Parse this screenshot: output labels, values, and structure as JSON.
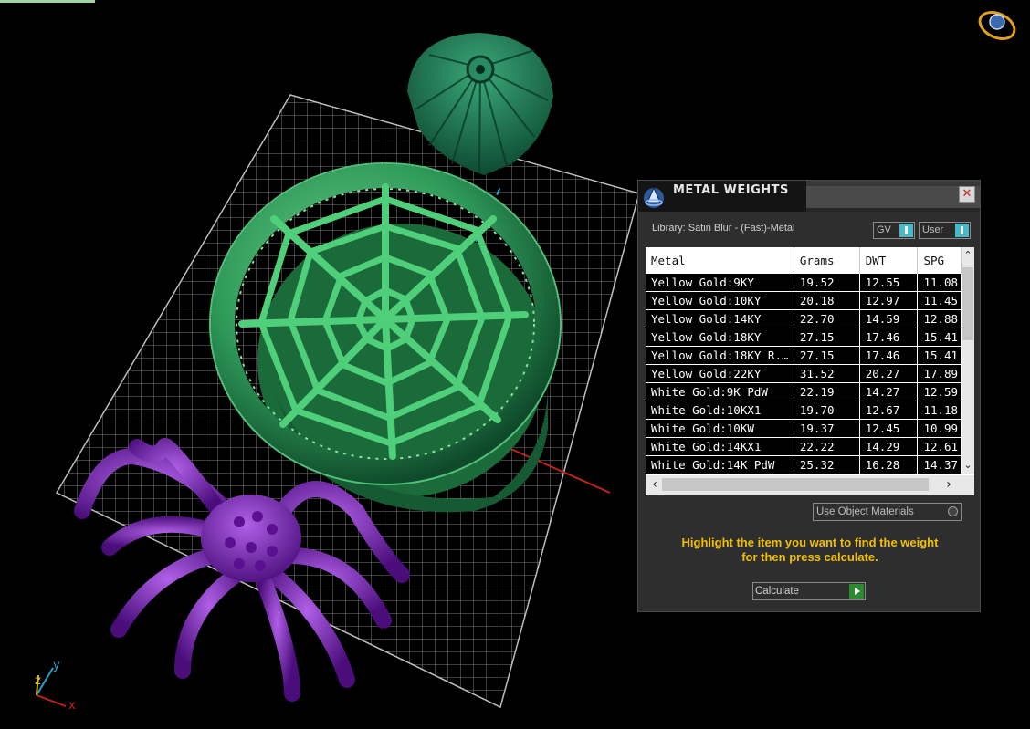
{
  "panel": {
    "title": "METAL WEIGHTS",
    "library_text": "Library: Satin Blur - (Fast)-Metal",
    "toggle_gv": "GV",
    "toggle_user": "User",
    "table": {
      "columns": [
        "Metal",
        "Grams",
        "DWT",
        "SPG"
      ],
      "rows": [
        [
          "Yellow Gold:9KY",
          "19.52",
          "12.55",
          "11.08"
        ],
        [
          "Yellow Gold:10KY",
          "20.18",
          "12.97",
          "11.45"
        ],
        [
          "Yellow Gold:14KY",
          "22.70",
          "14.59",
          "12.88"
        ],
        [
          "Yellow Gold:18KY",
          "27.15",
          "17.46",
          "15.41"
        ],
        [
          "Yellow Gold:18KY R...",
          "27.15",
          "17.46",
          "15.41"
        ],
        [
          "Yellow Gold:22KY",
          "31.52",
          "20.27",
          "17.89"
        ],
        [
          "White Gold:9K PdW",
          "22.19",
          "14.27",
          "12.59"
        ],
        [
          "White Gold:10KX1",
          "19.70",
          "12.67",
          "11.18"
        ],
        [
          "White Gold:10KW",
          "19.37",
          "12.45",
          "10.99"
        ],
        [
          "White Gold:14KX1",
          "22.22",
          "14.29",
          "12.61"
        ],
        [
          "White Gold:14K PdW",
          "25.32",
          "16.28",
          "14.37"
        ]
      ]
    },
    "use_object_materials": "Use Object Materials",
    "hint_line1": "Highlight the item you want to find the weight",
    "hint_line2": "for then press calculate.",
    "calculate_label": "Calculate"
  },
  "axis_labels": {
    "x": "x",
    "y": "y",
    "z": "z"
  },
  "colors": {
    "ring": "#2f9a5a",
    "pendant": "#1f7a52",
    "spider": "#7a22b8",
    "hint": "#f0c000",
    "accent": "#49b8c8"
  },
  "icons": [
    "view-cube-icon",
    "metal-weights-icon",
    "close-icon",
    "play-icon",
    "radio-icon",
    "scroll-arrow-icon"
  ]
}
